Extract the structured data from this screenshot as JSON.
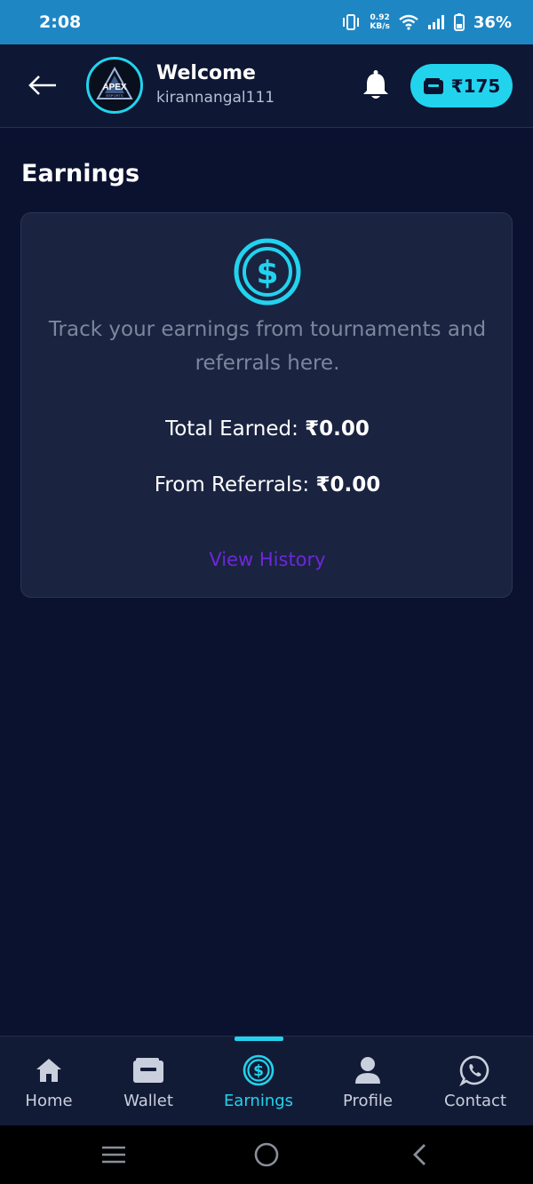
{
  "statusbar": {
    "time": "2:08",
    "net_speed_value": "0.92",
    "net_speed_unit": "KB/s",
    "battery": "36%"
  },
  "header": {
    "welcome": "Welcome",
    "username": "kirannangal111",
    "balance": "₹175",
    "logo_text": "APEX",
    "logo_subtext": "ESPORTS"
  },
  "page": {
    "title": "Earnings"
  },
  "card": {
    "description": "Track your earnings from tournaments and referrals here.",
    "total_label": "Total Earned: ",
    "total_value": "₹0.00",
    "referrals_label": "From Referrals: ",
    "referrals_value": "₹0.00",
    "history_link": "View History"
  },
  "nav": {
    "home": "Home",
    "wallet": "Wallet",
    "earnings": "Earnings",
    "profile": "Profile",
    "contact": "Contact"
  },
  "colors": {
    "accent": "#22d3ee",
    "background": "#0b1230",
    "card": "#1a2340",
    "link": "#6d28d9"
  }
}
